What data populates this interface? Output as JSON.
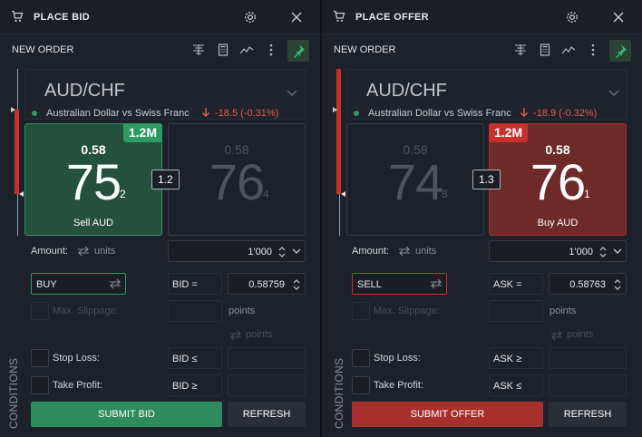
{
  "bid": {
    "title": "PLACE BID",
    "subtitle": "NEW ORDER",
    "pair": "AUD/CHF",
    "description": "Australian Dollar vs Swiss Franc",
    "change": "-18.5 (-0.31%)",
    "left_tile": {
      "size": "1.2M",
      "prefix": "0.58",
      "big": "75",
      "pip": "2",
      "label": "Sell AUD"
    },
    "right_tile": {
      "prefix": "0.58",
      "big": "76",
      "pip": "4"
    },
    "spread": "1.2",
    "amount_label": "Amount:",
    "units_label": "units",
    "amount_value": "1'000",
    "side_value": "BUY",
    "price_ref": "BID =",
    "price_value": "0.58759",
    "slippage_label": "Max. Slippage:",
    "points_label": "points",
    "points_sub": "points",
    "stop_loss_label": "Stop Loss:",
    "stop_loss_ref": "BID ≤",
    "take_profit_label": "Take Profit:",
    "take_profit_ref": "BID ≥",
    "conditions_label": "CONDITIONS",
    "submit_label": "SUBMIT BID",
    "refresh_label": "REFRESH"
  },
  "offer": {
    "title": "PLACE OFFER",
    "subtitle": "NEW ORDER",
    "pair": "AUD/CHF",
    "description": "Australian Dollar vs Swiss Franc",
    "change": "-18.9 (-0.32%)",
    "left_tile": {
      "prefix": "0.58",
      "big": "74",
      "pip": "8"
    },
    "right_tile": {
      "size": "1.2M",
      "prefix": "0.58",
      "big": "76",
      "pip": "1",
      "label": "Buy AUD"
    },
    "spread": "1.3",
    "amount_label": "Amount:",
    "units_label": "units",
    "amount_value": "1'000",
    "side_value": "SELL",
    "price_ref": "ASK =",
    "price_value": "0.58763",
    "slippage_label": "Max. Slippage:",
    "points_label": "points",
    "points_sub": "points",
    "stop_loss_label": "Stop Loss:",
    "stop_loss_ref": "ASK ≥",
    "take_profit_label": "Take Profit:",
    "take_profit_ref": "ASK ≤",
    "conditions_label": "CONDITIONS",
    "submit_label": "SUBMIT OFFER",
    "refresh_label": "REFRESH"
  },
  "colors": {
    "buy_green": "#2e8b5f",
    "sell_red": "#a8302c",
    "down_red": "#e85a55",
    "panel_bg": "#1d2129"
  },
  "icons": [
    "cart-icon",
    "gear-icon",
    "close-icon",
    "ladder-icon",
    "calculator-icon",
    "chart-icon",
    "more-icon",
    "pin-icon",
    "swap-icon",
    "down-arrow-icon",
    "chevron-down-icon",
    "spinner-icon"
  ]
}
